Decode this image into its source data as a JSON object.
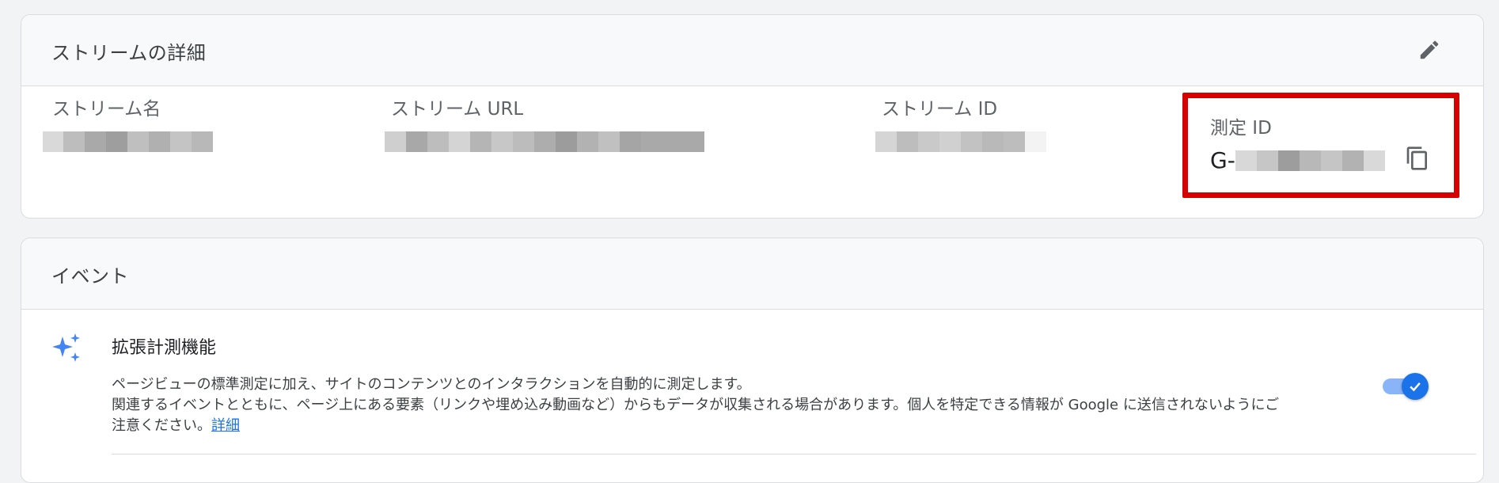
{
  "stream_details": {
    "title": "ストリームの詳細",
    "edit_icon": "pencil-icon",
    "fields": {
      "stream_name_label": "ストリーム名",
      "stream_url_label": "ストリーム URL",
      "stream_id_label": "ストリーム ID",
      "measurement_id_label": "測定 ID",
      "measurement_id_prefix": "G-"
    },
    "copy_icon": "copy-icon",
    "highlight_color": "#d60000"
  },
  "events": {
    "title": "イベント",
    "enhanced_measurement": {
      "icon": "sparkle-icon",
      "title": "拡張計測機能",
      "description_line1": "ページビューの標準測定に加え、サイトのコンテンツとのインタラクションを自動的に測定します。",
      "description_line2": "関連するイベントとともに、ページ上にある要素（リンクや埋め込み動画など）からもデータが収集される場合があります。個人を特定できる情報が Google に送信されないようにご",
      "description_line3": "注意ください。",
      "link_label": "詳細",
      "toggle_on": true
    }
  },
  "colors": {
    "accent": "#1a73e8",
    "toggle_track": "#8ab4f8",
    "border": "#dadce0"
  }
}
